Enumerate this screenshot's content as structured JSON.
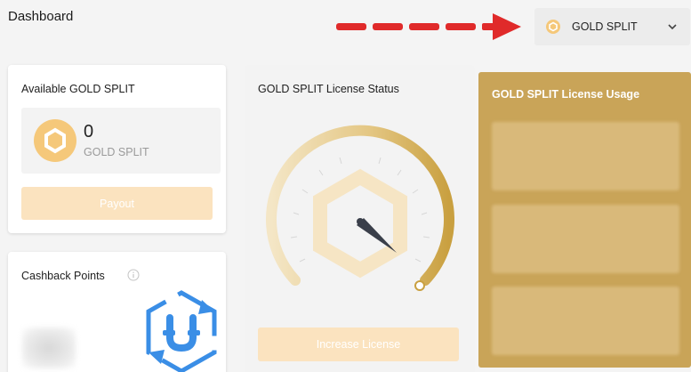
{
  "header": {
    "title": "Dashboard",
    "token_selector": {
      "selected": "GOLD SPLIT",
      "icon": "coin-icon"
    }
  },
  "available_card": {
    "title": "Available GOLD SPLIT",
    "amount": "0",
    "unit": "GOLD SPLIT",
    "payout_label": "Payout"
  },
  "cashback_card": {
    "title": "Cashback Points",
    "icon": "info-icon"
  },
  "license_status_card": {
    "title": "GOLD SPLIT License Status",
    "increase_label": "Increase License"
  },
  "license_usage_card": {
    "title": "GOLD SPLIT License Usage"
  },
  "colors": {
    "gold": "#c9a458",
    "gold_light": "#fbe3bf",
    "coin": "#f5c87a",
    "arrow_red": "#e02a2a",
    "cashback_blue": "#3a8ee6"
  }
}
